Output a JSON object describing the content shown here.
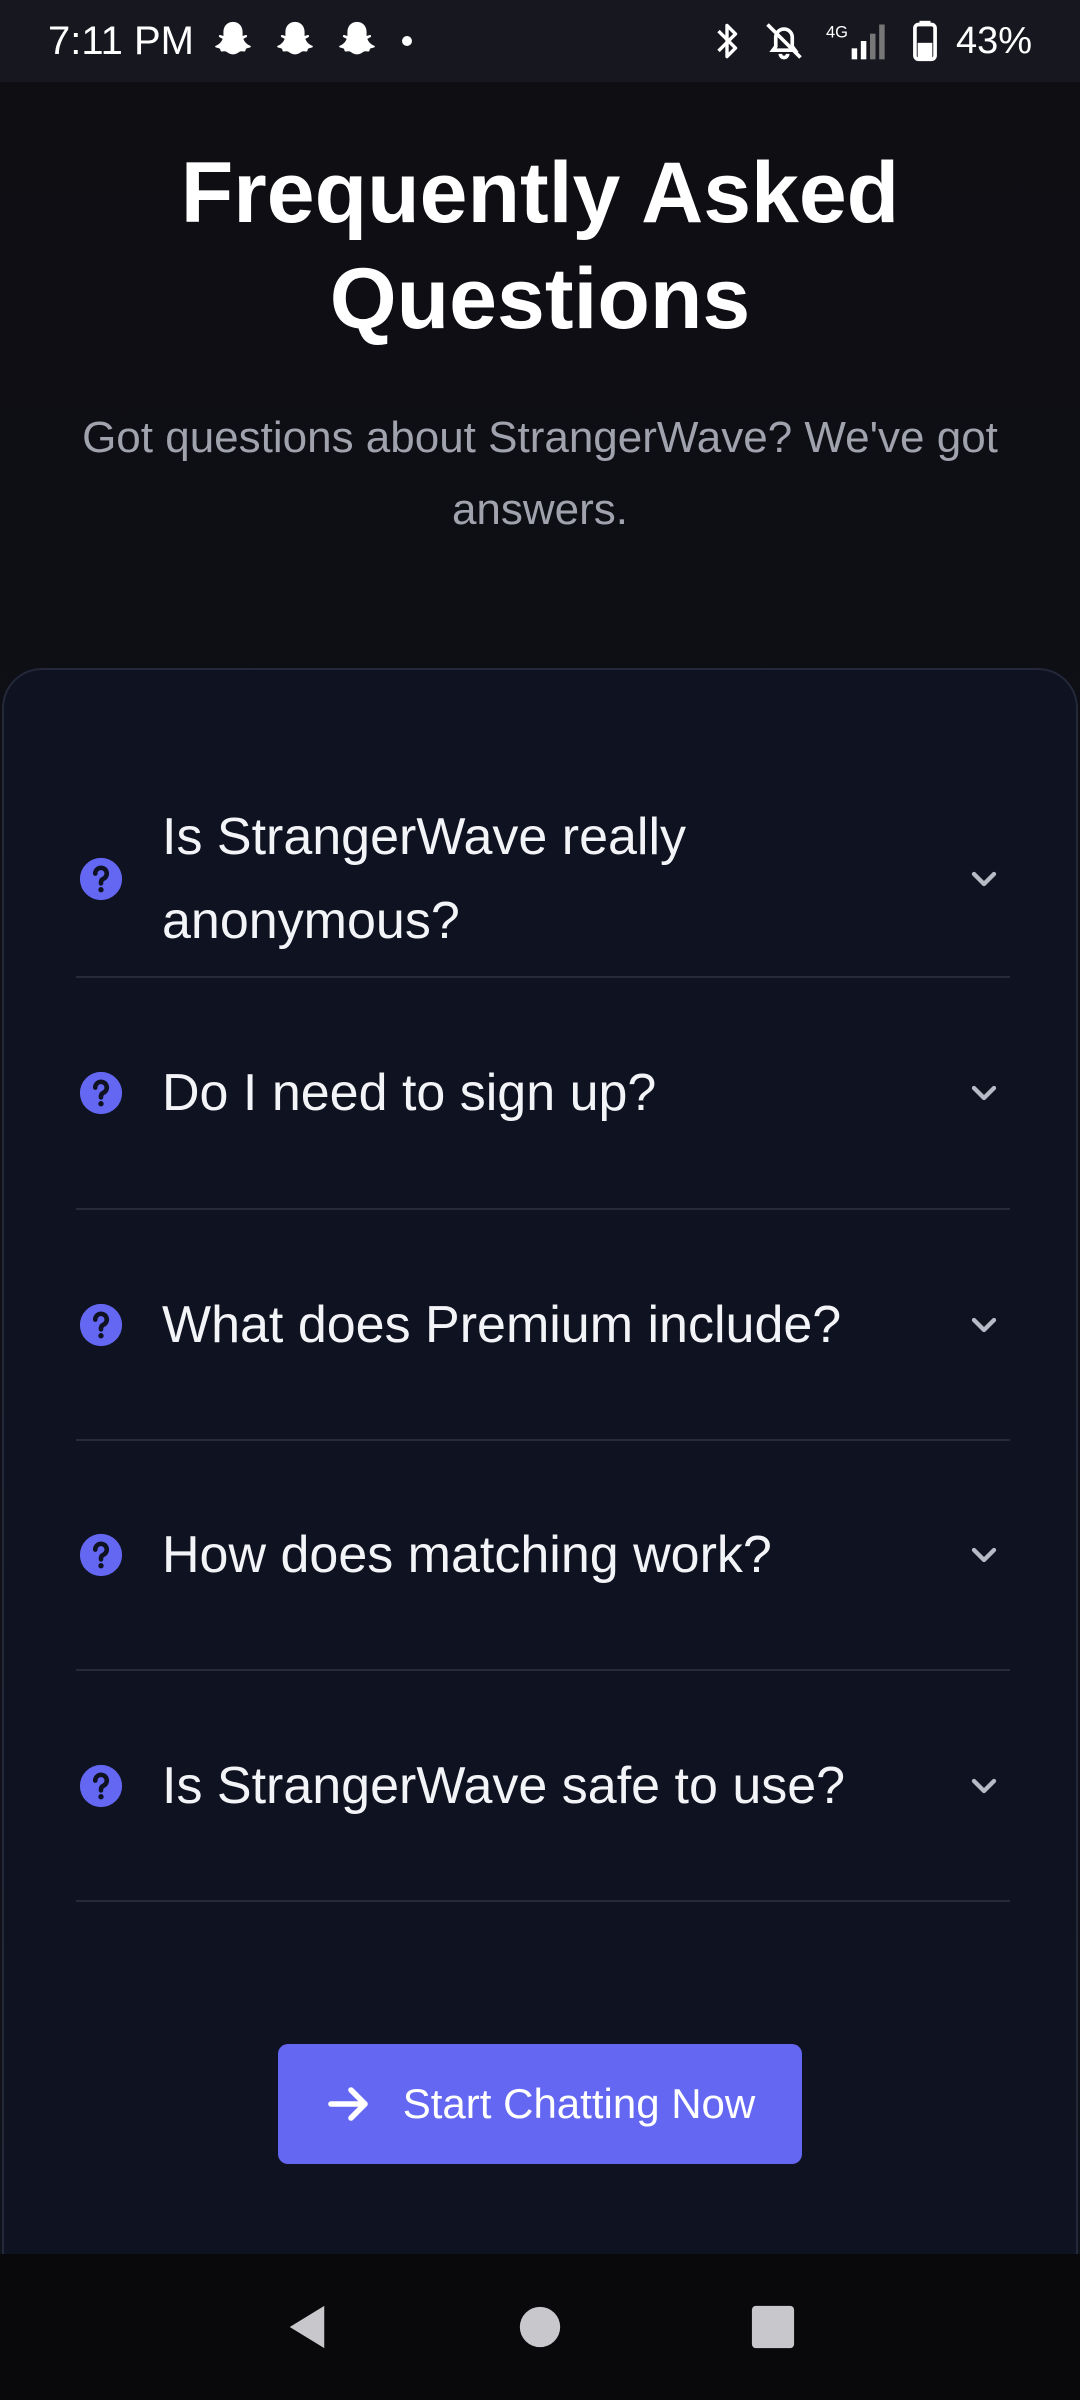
{
  "status_bar": {
    "time": "7:11 PM",
    "notification_icons": [
      "snapchat-icon",
      "snapchat-icon",
      "snapchat-icon"
    ],
    "network": "4G",
    "battery": "43%"
  },
  "header": {
    "title": "Frequently Asked Questions",
    "subtitle": "Got questions about StrangerWave? We've got answers."
  },
  "faq": {
    "items": [
      {
        "question": "Is StrangerWave really anonymous?"
      },
      {
        "question": "Do I need to sign up?"
      },
      {
        "question": "What does Premium include?"
      },
      {
        "question": "How does matching work?"
      },
      {
        "question": "Is StrangerWave safe to use?"
      }
    ]
  },
  "cta": {
    "label": "Start Chatting Now",
    "icon": "arrow-right-icon"
  },
  "colors": {
    "accent": "#6467f2",
    "background": "#0e0e13",
    "card": "#0f1220",
    "subtitle": "#a0a3ad"
  }
}
